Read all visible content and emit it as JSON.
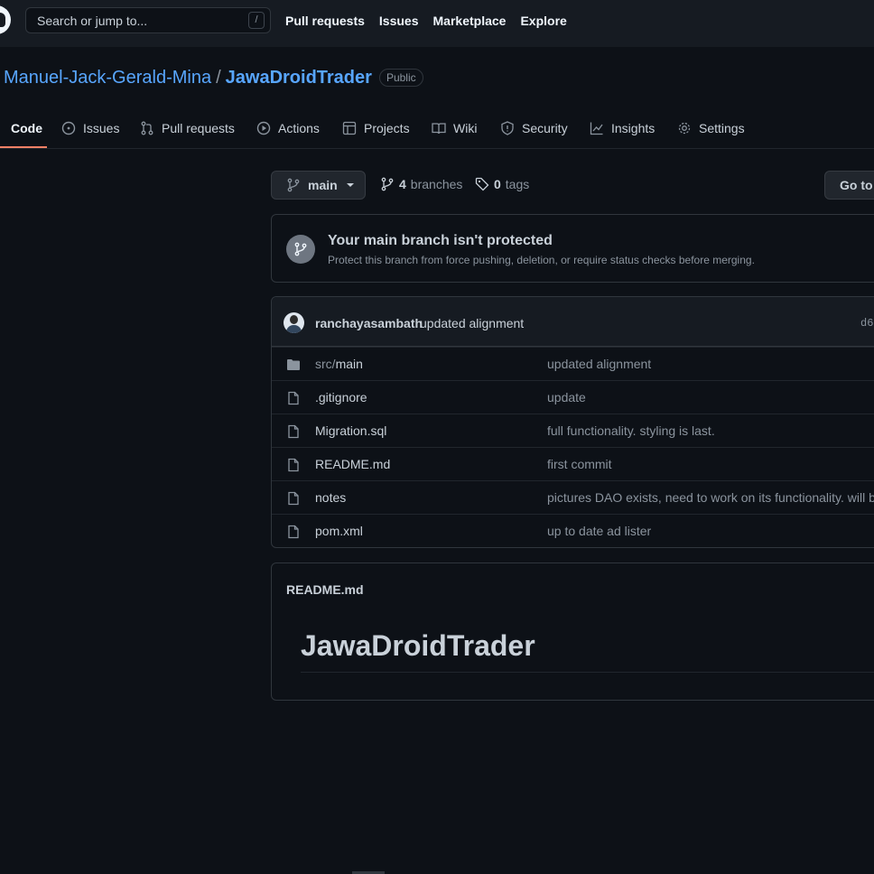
{
  "header": {
    "search_placeholder": "Search or jump to...",
    "search_shortcut": "/",
    "nav": [
      "Pull requests",
      "Issues",
      "Marketplace",
      "Explore"
    ]
  },
  "repo": {
    "owner": "Manuel-Jack-Gerald-Mina",
    "separator": "/",
    "name": "JawaDroidTrader",
    "visibility": "Public"
  },
  "tabs": [
    {
      "label": "Code",
      "icon": "code-icon",
      "active": true
    },
    {
      "label": "Issues",
      "icon": "issue-icon"
    },
    {
      "label": "Pull requests",
      "icon": "pull-request-icon"
    },
    {
      "label": "Actions",
      "icon": "play-icon"
    },
    {
      "label": "Projects",
      "icon": "table-icon"
    },
    {
      "label": "Wiki",
      "icon": "book-icon"
    },
    {
      "label": "Security",
      "icon": "shield-icon"
    },
    {
      "label": "Insights",
      "icon": "graph-icon"
    },
    {
      "label": "Settings",
      "icon": "gear-icon"
    }
  ],
  "branch": {
    "current": "main",
    "branches_count": "4",
    "branches_label": "branches",
    "tags_count": "0",
    "tags_label": "tags",
    "goto_label": "Go to"
  },
  "protection": {
    "title": "Your main branch isn't protected",
    "description": "Protect this branch from force pushing, deletion, or require status checks before merging."
  },
  "commit": {
    "author": "ranchayasambath",
    "message": "updated alignment",
    "sha": "d6"
  },
  "files": [
    {
      "type": "folder",
      "prefix": "src/",
      "name": "main",
      "message": "updated alignment"
    },
    {
      "type": "file",
      "prefix": "",
      "name": ".gitignore",
      "message": "update"
    },
    {
      "type": "file",
      "prefix": "",
      "name": "Migration.sql",
      "message": "full functionality. styling is last."
    },
    {
      "type": "file",
      "prefix": "",
      "name": "README.md",
      "message": "first commit"
    },
    {
      "type": "file",
      "prefix": "",
      "name": "notes",
      "message": "pictures DAO exists, need to work on its functionality. will b"
    },
    {
      "type": "file",
      "prefix": "",
      "name": "pom.xml",
      "message": "up to date ad lister"
    }
  ],
  "readme": {
    "filename": "README.md",
    "heading": "JawaDroidTrader"
  },
  "colors": {
    "background": "#0d1117",
    "header": "#161b22",
    "link": "#58a6ff",
    "active_tab_underline": "#f78166"
  }
}
